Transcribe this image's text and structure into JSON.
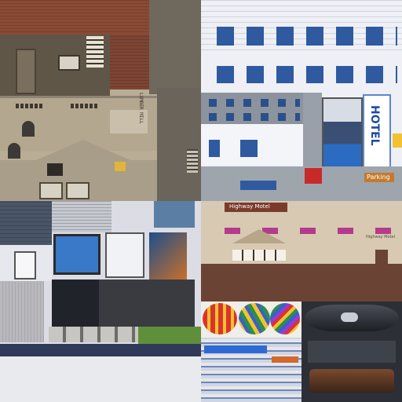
{
  "atlas": {
    "colors": {
      "brick": "#8a4a35",
      "stone": "#b9ad96",
      "stone_dark": "#8d8472",
      "white_facade": "#eef0f6",
      "window_blue": "#2f5aa0",
      "slate_roof": "#4a5568",
      "gray_block": "#9aa0aa",
      "motel_wall": "#d8c9b2",
      "roof_brown": "#6b4334",
      "balloon_red": "#d9342b",
      "balloon_yellow": "#f2c230",
      "jet_dark": "#2c2f36"
    },
    "signs": {
      "lumber_mill": "LUMBER MILL",
      "hotel": "HOTEL",
      "parking": "Parking",
      "highway_motel_top": "Highway Motel",
      "highway_motel_bottom": "Highway Motel"
    },
    "icons": {
      "balloon_1": "hot-air-balloon-icon",
      "balloon_2": "hot-air-balloon-icon",
      "balloon_3": "hot-air-balloon-icon",
      "jet_body": "jet-fuselage-icon"
    }
  }
}
